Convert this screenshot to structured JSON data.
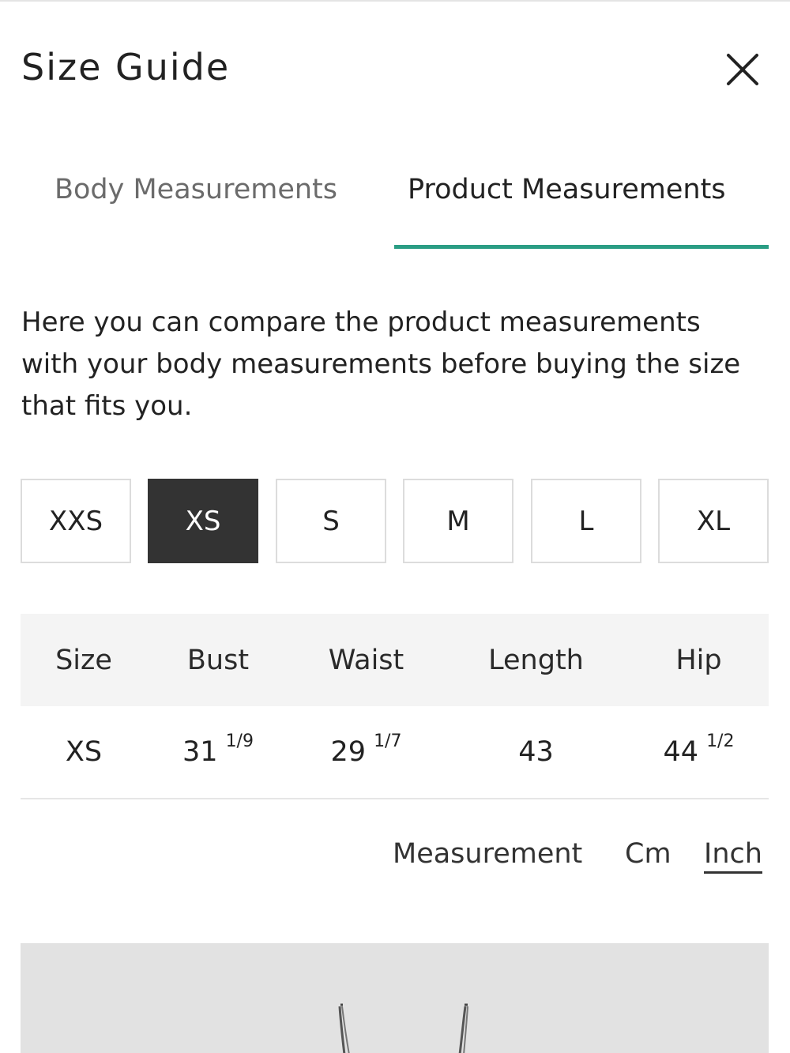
{
  "header": {
    "title": "Size Guide",
    "close_icon": "close-icon"
  },
  "tabs": [
    {
      "label": "Body Measurements",
      "active": false
    },
    {
      "label": "Product Measurements",
      "active": true
    }
  ],
  "accent_color": "#2a9d84",
  "intro_text": "Here you can compare the product measurements with your body measurements before buying the size that fits you.",
  "sizes": [
    {
      "label": "XXS",
      "selected": false
    },
    {
      "label": "XS",
      "selected": true
    },
    {
      "label": "S",
      "selected": false
    },
    {
      "label": "M",
      "selected": false
    },
    {
      "label": "L",
      "selected": false
    },
    {
      "label": "XL",
      "selected": false
    }
  ],
  "table": {
    "headers": [
      "Size",
      "Bust",
      "Waist",
      "Length",
      "Hip"
    ],
    "row": {
      "size": "XS",
      "bust": {
        "whole": "31",
        "fraction": "1/9"
      },
      "waist": {
        "whole": "29",
        "fraction": "1/7"
      },
      "length": {
        "whole": "43",
        "fraction": ""
      },
      "hip": {
        "whole": "44",
        "fraction": "1/2"
      }
    }
  },
  "units": {
    "label": "Measurement",
    "options": [
      "Cm",
      "Inch"
    ],
    "selected": "Inch"
  }
}
